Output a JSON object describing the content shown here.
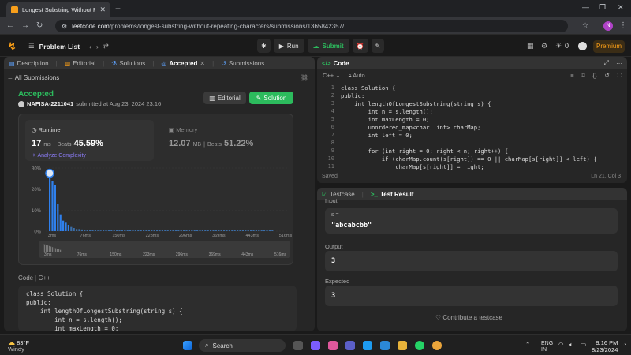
{
  "browser": {
    "tab_title": "Longest Substring Without Rep",
    "url_prefix": "leetcode.com",
    "url_rest": "/problems/longest-substring-without-repeating-characters/submissions/1365842357/",
    "profile_initial": "N"
  },
  "header": {
    "problem_list": "Problem List",
    "run": "Run",
    "submit": "Submit",
    "notif_count": "0",
    "premium": "Premium"
  },
  "left_panel": {
    "tabs": [
      "Description",
      "Editorial",
      "Solutions",
      "Accepted",
      "Submissions"
    ],
    "all_submissions": "All Submissions",
    "status": "Accepted",
    "user": "NAFISA-2211041",
    "submitted": "submitted at Aug 23, 2024 23:16",
    "editorial_btn": "Editorial",
    "solution_btn": "Solution",
    "runtime": {
      "label": "Runtime",
      "value": "17",
      "unit": "ms",
      "beats_label": "Beats",
      "beats": "45.59%",
      "analyze": "Analyze Complexity"
    },
    "memory": {
      "label": "Memory",
      "value": "12.07",
      "unit": "MB",
      "beats_label": "Beats",
      "beats": "51.22%"
    },
    "code_label": "Code",
    "code_lang": "C++",
    "code_lines": [
      "class Solution {",
      "public:",
      "    int lengthOfLongestSubstring(string s) {",
      "        int n = s.length();",
      "        int maxLength = 0;"
    ]
  },
  "chart_data": {
    "type": "bar",
    "y_ticks": [
      "30%",
      "20%",
      "10%",
      "0%"
    ],
    "ylim": [
      0,
      30
    ],
    "x_ticks": [
      "3ms",
      "76ms",
      "150ms",
      "223ms",
      "296ms",
      "369ms",
      "443ms",
      "516ms"
    ],
    "mini_ticks": [
      "3ms",
      "76ms",
      "150ms",
      "223ms",
      "296ms",
      "369ms",
      "443ms",
      "516ms"
    ],
    "values": [
      26,
      24,
      22,
      13,
      8,
      5,
      4,
      3,
      2,
      1.5,
      1,
      1,
      0.8,
      0.6,
      0.5,
      0.5,
      0.4,
      0.4,
      0.3,
      0.3
    ]
  },
  "editor": {
    "lang": "C++",
    "mode": "Auto",
    "line_numbers": [
      "1",
      "2",
      "3",
      "4",
      "5",
      "6",
      "7",
      "8",
      "9",
      "10",
      "11"
    ],
    "lines": [
      "class Solution {",
      "public:",
      "    int lengthOfLongestSubstring(string s) {",
      "        int n = s.length();",
      "        int maxLength = 0;",
      "        unordered_map<char, int> charMap;",
      "        int left = 0;",
      "",
      "        for (int right = 0; right < n; right++) {",
      "            if (charMap.count(s[right]) == 0 || charMap[s[right]] < left) {",
      "                charMap[s[right]] = right;"
    ],
    "status": "Saved",
    "position": "Ln 21, Col 3"
  },
  "test_panel": {
    "tabs": [
      "Testcase",
      "Test Result"
    ],
    "input_label": "Input",
    "var_label": "s =",
    "input_value": "\"abcabcbb\"",
    "output_label": "Output",
    "output_value": "3",
    "expected_label": "Expected",
    "expected_value": "3",
    "contribute": "Contribute a testcase"
  },
  "taskbar": {
    "temp": "83°F",
    "weather": "Windy",
    "search": "Search",
    "lang1": "ENG",
    "lang2": "IN",
    "time": "9:16 PM",
    "date": "8/23/2024"
  }
}
